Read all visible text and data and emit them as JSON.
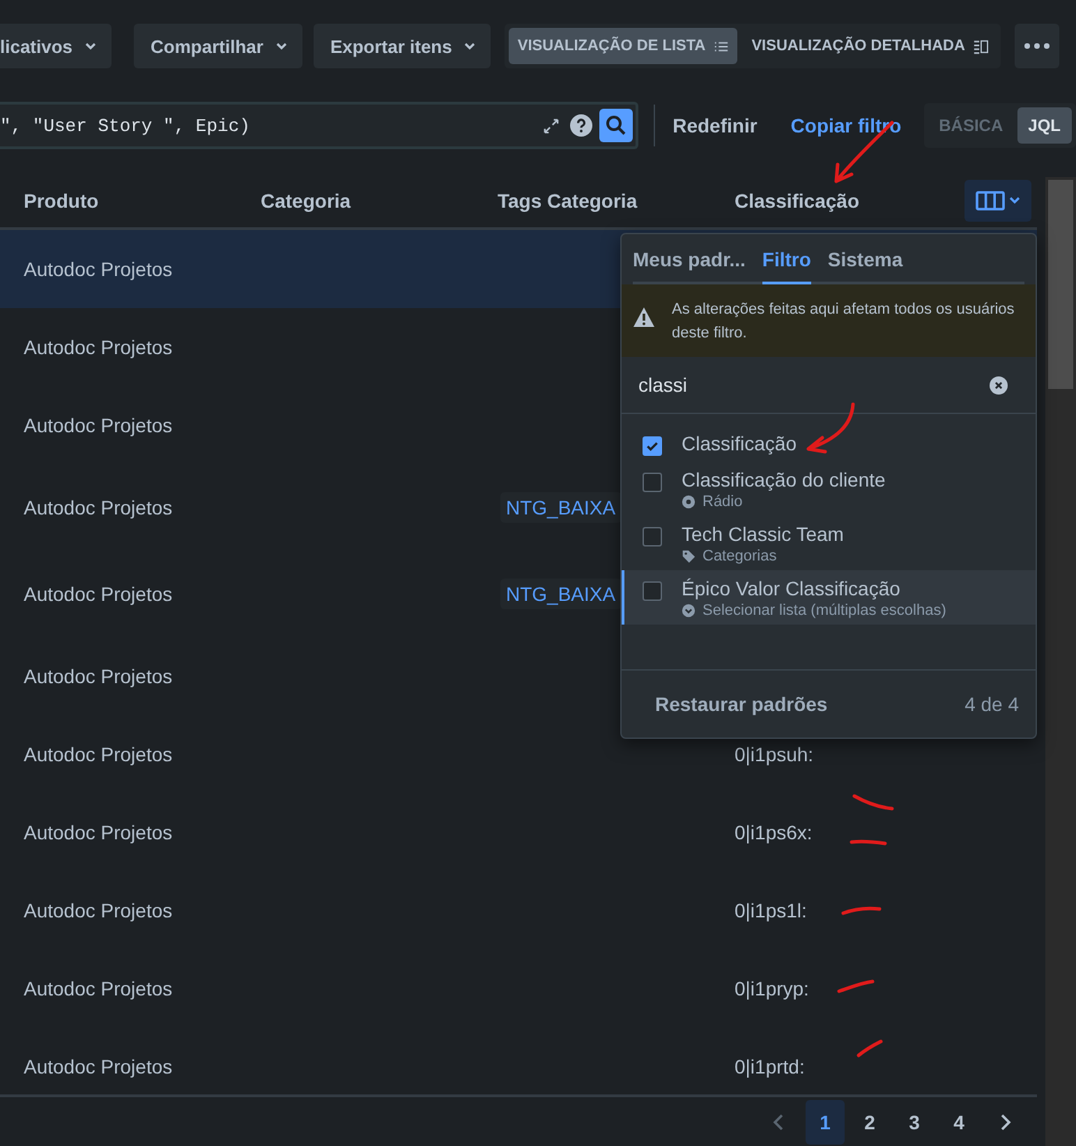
{
  "toolbar": {
    "buttons": [
      {
        "label": "licativos"
      },
      {
        "label": "Compartilhar"
      },
      {
        "label": "Exportar itens"
      }
    ],
    "views": [
      {
        "label": "VISUALIZAÇÃO DE LISTA",
        "selected": true
      },
      {
        "label": "VISUALIZAÇÃO DETALHADA",
        "selected": false
      }
    ]
  },
  "filter": {
    "query": "\", \"User Story \", Epic)",
    "reset": "Redefinir",
    "copy": "Copiar filtro",
    "modes": [
      {
        "label": "BÁSICA",
        "selected": false
      },
      {
        "label": "JQL",
        "selected": true
      }
    ]
  },
  "table": {
    "columns": [
      "Produto",
      "Categoria",
      "Tags Categoria",
      "Classificação"
    ],
    "rows": [
      {
        "selected": true,
        "produto": "Autodoc Projetos"
      },
      {
        "selected": false,
        "produto": "Autodoc Projetos"
      },
      {
        "selected": false,
        "produto": "Autodoc Projetos"
      },
      {
        "selected": false,
        "produto": "Autodoc Projetos",
        "tag": "NTG_BAIXA"
      },
      {
        "selected": false,
        "produto": "Autodoc Projetos",
        "tag": "NTG_BAIXA"
      },
      {
        "selected": false,
        "produto": "Autodoc Projetos"
      },
      {
        "selected": false,
        "produto": "Autodoc Projetos",
        "classificacao": "0|i1psuh:"
      },
      {
        "selected": false,
        "produto": "Autodoc Projetos",
        "classificacao": "0|i1ps6x:"
      },
      {
        "selected": false,
        "produto": "Autodoc Projetos",
        "classificacao": "0|i1ps1l:"
      },
      {
        "selected": false,
        "produto": "Autodoc Projetos",
        "classificacao": "0|i1pryp:"
      },
      {
        "selected": false,
        "produto": "Autodoc Projetos",
        "classificacao": "0|i1prtd:"
      }
    ]
  },
  "column_picker": {
    "tabs": [
      {
        "label": "Meus padr...",
        "selected": false
      },
      {
        "label": "Filtro",
        "selected": true
      },
      {
        "label": "Sistema",
        "selected": false
      }
    ],
    "warning": "As alterações feitas aqui afetam todos os usuários deste filtro.",
    "search": "classi",
    "fields": [
      {
        "label": "Classificação",
        "checked": true,
        "highlighted": false
      },
      {
        "label": "Classificação do cliente",
        "type": "Rádio",
        "kind": "radio",
        "checked": false,
        "highlighted": false
      },
      {
        "label": "Tech Classic Team",
        "type": "Categorias",
        "kind": "tag",
        "checked": false,
        "highlighted": false
      },
      {
        "label": "Épico Valor Classificação",
        "type": "Selecionar lista (múltiplas escolhas)",
        "kind": "select",
        "checked": false,
        "highlighted": true
      }
    ],
    "restore": "Restaurar padrões",
    "count": "4 de 4"
  },
  "pagination": {
    "pages": [
      {
        "label": "1",
        "selected": true
      },
      {
        "label": "2",
        "selected": false
      },
      {
        "label": "3",
        "selected": false
      },
      {
        "label": "4",
        "selected": false
      }
    ]
  }
}
